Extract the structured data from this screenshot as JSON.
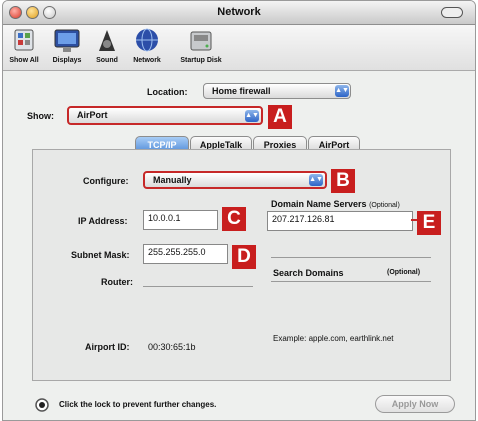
{
  "window": {
    "title": "Network"
  },
  "toolbar": {
    "items": [
      {
        "label": "Show All",
        "icon": "show-all-icon"
      },
      {
        "label": "Displays",
        "icon": "displays-icon"
      },
      {
        "label": "Sound",
        "icon": "sound-icon"
      },
      {
        "label": "Network",
        "icon": "network-icon"
      },
      {
        "label": "Startup Disk",
        "icon": "startup-disk-icon"
      }
    ]
  },
  "location": {
    "label": "Location:",
    "value": "Home firewall"
  },
  "show": {
    "label": "Show:",
    "value": "AirPort"
  },
  "tabs": [
    "TCP/IP",
    "AppleTalk",
    "Proxies",
    "AirPort"
  ],
  "active_tab": "TCP/IP",
  "configure": {
    "label": "Configure:",
    "value": "Manually"
  },
  "ip_address": {
    "label": "IP Address:",
    "value": "10.0.0.1"
  },
  "subnet_mask": {
    "label": "Subnet Mask:",
    "value": "255.255.255.0"
  },
  "router": {
    "label": "Router:",
    "value": ""
  },
  "dns": {
    "label": "Domain Name Servers",
    "optional": "(Optional)",
    "value": "207.217.126.81"
  },
  "search_domains": {
    "label": "Search Domains",
    "optional": "(Optional)",
    "example": "Example: apple.com, earthlink.net"
  },
  "airport_id": {
    "label": "Airport ID:",
    "value": "00:30:65:1b"
  },
  "lock": {
    "text": "Click the lock to prevent further changes."
  },
  "apply_button": {
    "label": "Apply Now"
  },
  "callouts": [
    "A",
    "B",
    "C",
    "D",
    "E"
  ],
  "colors": {
    "callout": "#c81e1e",
    "tab_active": "#4f8ad8",
    "window_bg": "#eef0ee"
  }
}
